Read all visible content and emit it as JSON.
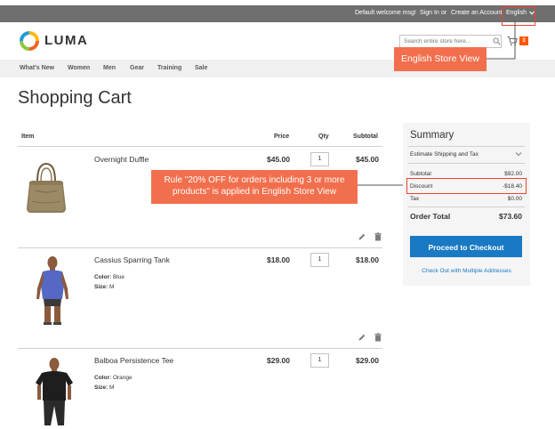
{
  "topbar": {
    "welcome": "Default welcome msg!",
    "sign_in": "Sign In",
    "or": "or",
    "create_account": "Create an Account",
    "language": "English"
  },
  "header": {
    "logo": "LUMA",
    "search_placeholder": "Search entire store here...",
    "cart_count": "3"
  },
  "nav": {
    "items": [
      "What's New",
      "Women",
      "Men",
      "Gear",
      "Training",
      "Sale"
    ]
  },
  "callouts": {
    "store_view": "English Store View",
    "rule_line1": "Rule \"20% OFF for orders including 3 or more",
    "rule_line2": "products\" is applied in English Store View"
  },
  "page": {
    "title": "Shopping Cart"
  },
  "cart": {
    "headers": {
      "item": "Item",
      "price": "Price",
      "qty": "Qty",
      "subtotal": "Subtotal"
    },
    "items": [
      {
        "name": "Overnight Duffle",
        "price": "$45.00",
        "qty": "1",
        "subtotal": "$45.00"
      },
      {
        "name": "Cassius Sparring Tank",
        "color_label": "Color:",
        "color": "Blue",
        "size_label": "Size:",
        "size": "M",
        "price": "$18.00",
        "qty": "1",
        "subtotal": "$18.00"
      },
      {
        "name": "Balboa Persistence Tee",
        "color_label": "Color:",
        "color": "Orange",
        "size_label": "Size:",
        "size": "M",
        "price": "$29.00",
        "qty": "1",
        "subtotal": "$29.00"
      }
    ]
  },
  "summary": {
    "title": "Summary",
    "estimate": "Estimate Shipping and Tax",
    "subtotal_label": "Subtotal",
    "subtotal": "$92.00",
    "discount_label": "Discount",
    "discount": "-$18.40",
    "tax_label": "Tax",
    "tax": "$0.00",
    "total_label": "Order Total",
    "total": "$73.60",
    "checkout_button": "Proceed to Checkout",
    "multi_address": "Check Out with Multiple Addresses"
  },
  "colors": {
    "accent": "#1979c3",
    "callout": "#f26f4d",
    "highlight_border": "#e8452f",
    "cart_badge": "#ff5501"
  }
}
